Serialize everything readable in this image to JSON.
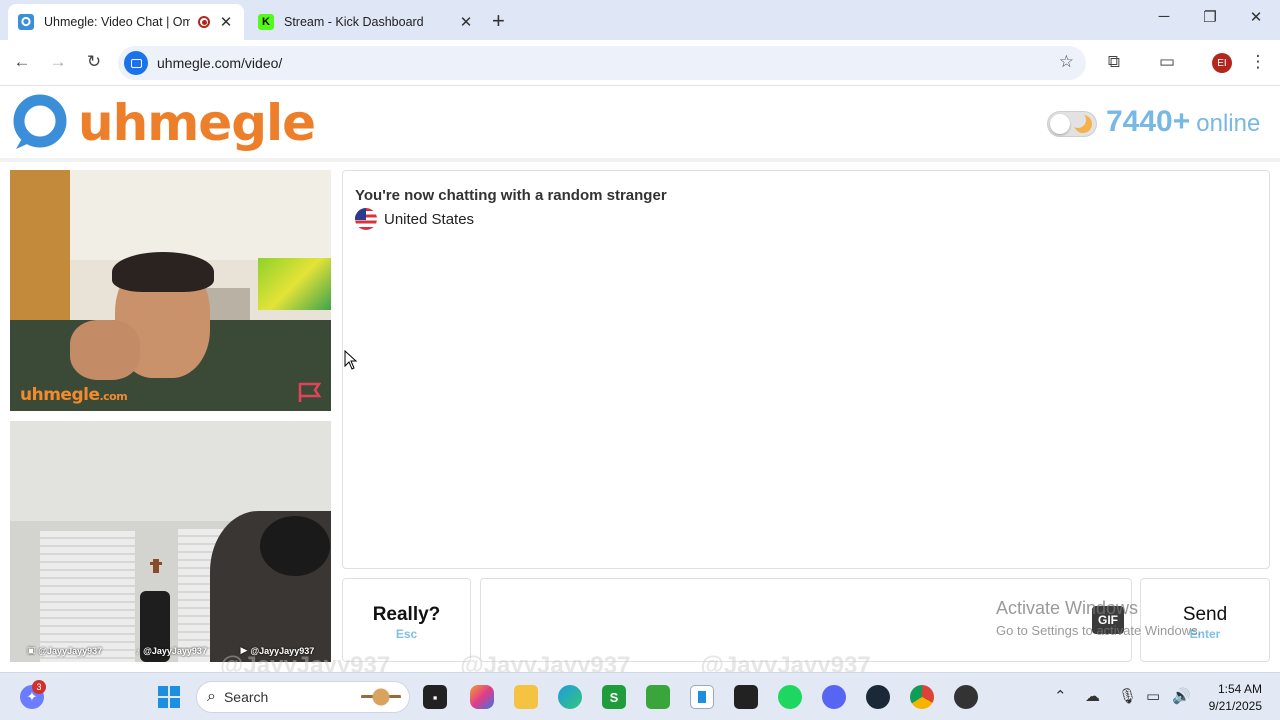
{
  "browser": {
    "tabs": [
      {
        "title": "Uhmegle: Video Chat | Ome",
        "active": true
      },
      {
        "title": "Stream - Kick Dashboard",
        "active": false
      }
    ],
    "url": "uhmegle.com/video/",
    "profile_initials": "EI"
  },
  "site": {
    "logo_text": "uhmegle",
    "online_count": "7440+",
    "online_label": "online",
    "stranger_watermark": "uhmegle",
    "stranger_watermark_suffix": ".com"
  },
  "self_video": {
    "handles": [
      "@JayyJayy937",
      "@JayyJayy937",
      "@JayyJayy937"
    ]
  },
  "chat": {
    "status": "You're now chatting with a random stranger",
    "country": "United States",
    "message_value": "",
    "gif_label": "GIF"
  },
  "controls": {
    "esc_label": "Really?",
    "esc_hint": "Esc",
    "send_label": "Send",
    "send_hint": "Enter"
  },
  "watermark": {
    "line1": "Activate Windows",
    "line2": "Go to Settings to activate Windows."
  },
  "stream_overlay": {
    "handles": [
      "@JayyJayy937",
      "@JayyJayy937",
      "@JayyJayy937"
    ]
  },
  "taskbar": {
    "search_placeholder": "Search",
    "widget_badge": "3",
    "time": "1:54 AM",
    "date": "9/21/2025"
  },
  "colors": {
    "brand_orange": "#ee7f2a",
    "brand_blue": "#3b8fd9",
    "online_blue": "#78b8e4",
    "hint_blue": "#7fc0e6"
  }
}
